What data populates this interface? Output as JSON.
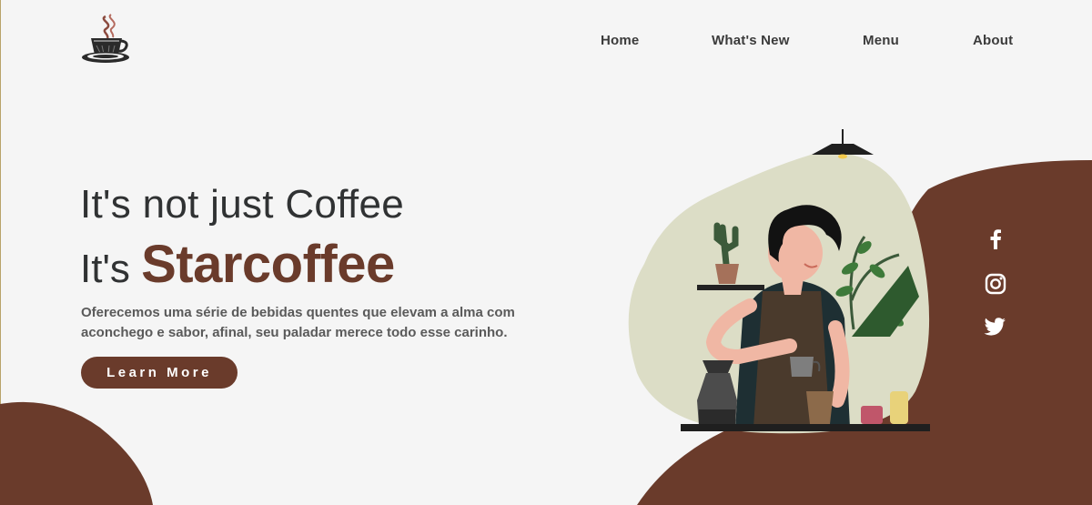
{
  "nav": {
    "items": [
      {
        "label": "Home"
      },
      {
        "label": "What's New"
      },
      {
        "label": "Menu"
      },
      {
        "label": "About"
      }
    ]
  },
  "hero": {
    "line1": "It's not just Coffee",
    "line2_prefix": "It's ",
    "brand": "Starcoffee",
    "description": "Oferecemos uma série de bebidas quentes que elevam a alma com aconchego e sabor, afinal, seu paladar merece todo esse carinho.",
    "cta_label": "Learn More"
  },
  "social": {
    "icons": [
      "facebook-icon",
      "instagram-icon",
      "twitter-icon"
    ]
  },
  "colors": {
    "brand_brown": "#6a3b2b",
    "background": "#f5f5f5",
    "text_dark": "#303233",
    "illustration_bg": "#dcddc6"
  }
}
